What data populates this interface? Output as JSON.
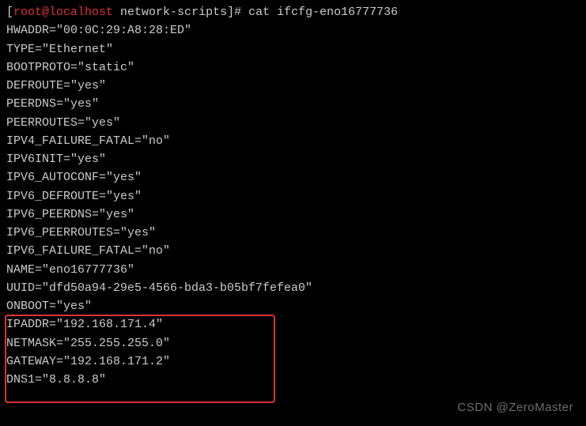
{
  "prompt": {
    "open": "[",
    "user_host": "root@localhost",
    "path": " network-scripts",
    "close": "]#",
    "command": " cat ifcfg-eno16777736"
  },
  "config_lines": [
    "HWADDR=\"00:0C:29:A8:28:ED\"",
    "TYPE=\"Ethernet\"",
    "BOOTPROTO=\"static\"",
    "DEFROUTE=\"yes\"",
    "PEERDNS=\"yes\"",
    "PEERROUTES=\"yes\"",
    "IPV4_FAILURE_FATAL=\"no\"",
    "IPV6INIT=\"yes\"",
    "IPV6_AUTOCONF=\"yes\"",
    "IPV6_DEFROUTE=\"yes\"",
    "IPV6_PEERDNS=\"yes\"",
    "IPV6_PEERROUTES=\"yes\"",
    "IPV6_FAILURE_FATAL=\"no\"",
    "NAME=\"eno16777736\"",
    "UUID=\"dfd50a94-29e5-4566-bda3-b05bf7fefea0\"",
    "ONBOOT=\"yes\"",
    "IPADDR=\"192.168.171.4\"",
    "NETMASK=\"255.255.255.0\"",
    "GATEWAY=\"192.168.171.2\"",
    "DNS1=\"8.8.8.8\""
  ],
  "watermark": "CSDN @ZeroMaster"
}
